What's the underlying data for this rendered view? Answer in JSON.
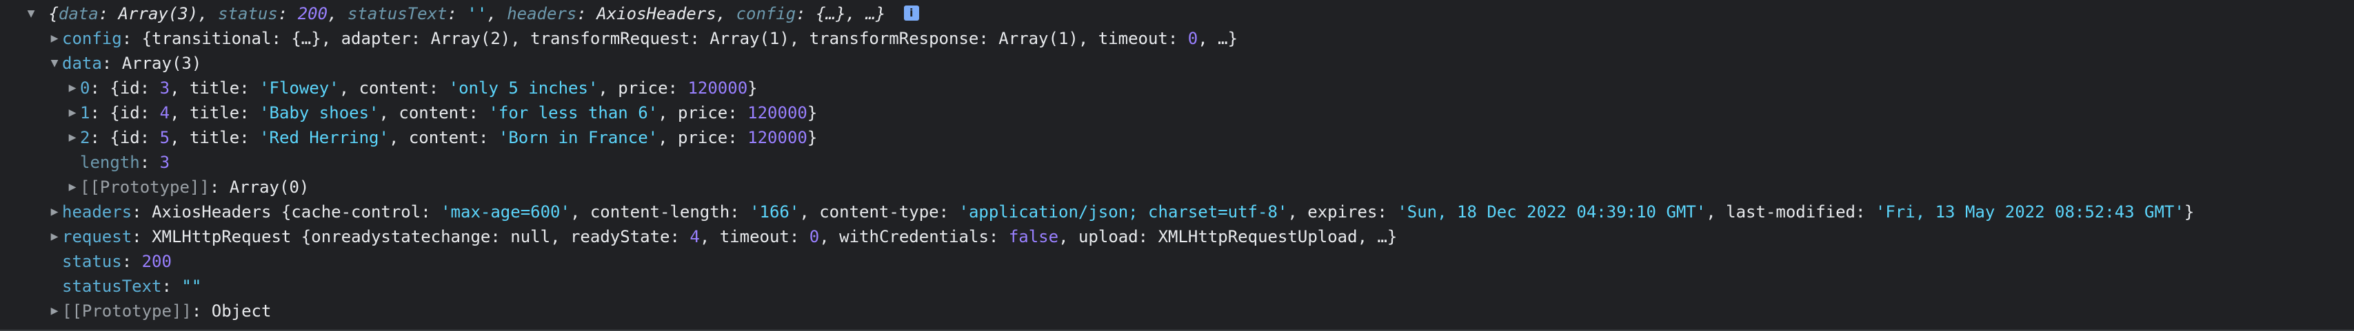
{
  "summary": {
    "open": "{",
    "data_key": "data",
    "data_val": "Array(3)",
    "status_key": "status",
    "status_val": "200",
    "statusText_key": "statusText",
    "statusText_val": "''",
    "headers_key": "headers",
    "headers_val": "AxiosHeaders",
    "config_key": "config",
    "config_val": "{…}",
    "tail": "…}",
    "info_icon": "i"
  },
  "config": {
    "key": "config",
    "preview_open": "{transitional: {…}, adapter: Array(2), transformRequest: Array(1), transformResponse: Array(1), timeout: ",
    "timeout": "0",
    "preview_close": ", …}"
  },
  "data": {
    "key": "data",
    "type": "Array(3)",
    "items": [
      {
        "index": "0",
        "id": "3",
        "title": "'Flowey'",
        "content": "'only 5 inches'",
        "price": "120000"
      },
      {
        "index": "1",
        "id": "4",
        "title": "'Baby shoes'",
        "content": "'for less than 6'",
        "price": "120000"
      },
      {
        "index": "2",
        "id": "5",
        "title": "'Red Herring'",
        "content": "'Born in France'",
        "price": "120000"
      }
    ],
    "length_key": "length",
    "length_val": "3",
    "proto_key": "[[Prototype]]",
    "proto_val": "Array(0)"
  },
  "headers": {
    "key": "headers",
    "class": "AxiosHeaders",
    "cache_control_key": "cache-control",
    "cache_control": "'max-age=600'",
    "content_length_key": "content-length",
    "content_length": "'166'",
    "content_type_key": "content-type",
    "content_type": "'application/json; charset=utf-8'",
    "expires_key": "expires",
    "expires": "'Sun, 18 Dec 2022 04:39:10 GMT'",
    "last_modified_key": "last-modified",
    "last_modified": "'Fri, 13 May 2022 08:52:43 GMT'"
  },
  "request": {
    "key": "request",
    "class": "XMLHttpRequest",
    "onreadystatechange_key": "onreadystatechange",
    "onreadystatechange": "null",
    "readyState_key": "readyState",
    "readyState": "4",
    "timeout_key": "timeout",
    "timeout": "0",
    "withCredentials_key": "withCredentials",
    "withCredentials": "false",
    "upload_key": "upload",
    "upload": "XMLHttpRequestUpload",
    "tail": ", …}"
  },
  "status": {
    "key": "status",
    "value": "200"
  },
  "statusText": {
    "key": "statusText",
    "value": "\"\""
  },
  "prototype": {
    "key": "[[Prototype]]",
    "value": "Object"
  },
  "colors": {
    "background": "#202124",
    "key": "#5db0d7",
    "string": "#5cd5fb",
    "number": "#9980ff",
    "text": "#e8eaed"
  }
}
